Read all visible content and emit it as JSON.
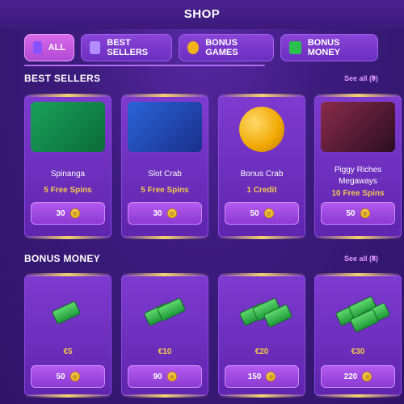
{
  "header": {
    "title": "SHOP"
  },
  "tabs": [
    {
      "label": "ALL",
      "icon": "cube-icon"
    },
    {
      "label": "BEST SELLERS",
      "icon": "gem-icon"
    },
    {
      "label": "BONUS GAMES",
      "icon": "bonus-coin-icon"
    },
    {
      "label": "BONUS MONEY",
      "icon": "cash-icon"
    }
  ],
  "sections": {
    "best_sellers": {
      "title": "BEST SELLERS",
      "see_all": "See all (9)",
      "items": [
        {
          "name": "Spinanga",
          "sub": "5 Free Spins",
          "price": "30"
        },
        {
          "name": "Slot Crab",
          "sub": "5 Free Spins",
          "price": "30"
        },
        {
          "name": "Bonus Crab",
          "sub": "1 Credit",
          "price": "50"
        },
        {
          "name": "Piggy Riches Megaways",
          "sub": "10 Free Spins",
          "price": "50"
        }
      ]
    },
    "bonus_money": {
      "title": "BONUS MONEY",
      "see_all": "See all (8)",
      "items": [
        {
          "name": "€5",
          "price": "50"
        },
        {
          "name": "€10",
          "price": "90"
        },
        {
          "name": "€20",
          "price": "150"
        },
        {
          "name": "€30",
          "price": "220"
        }
      ]
    }
  }
}
